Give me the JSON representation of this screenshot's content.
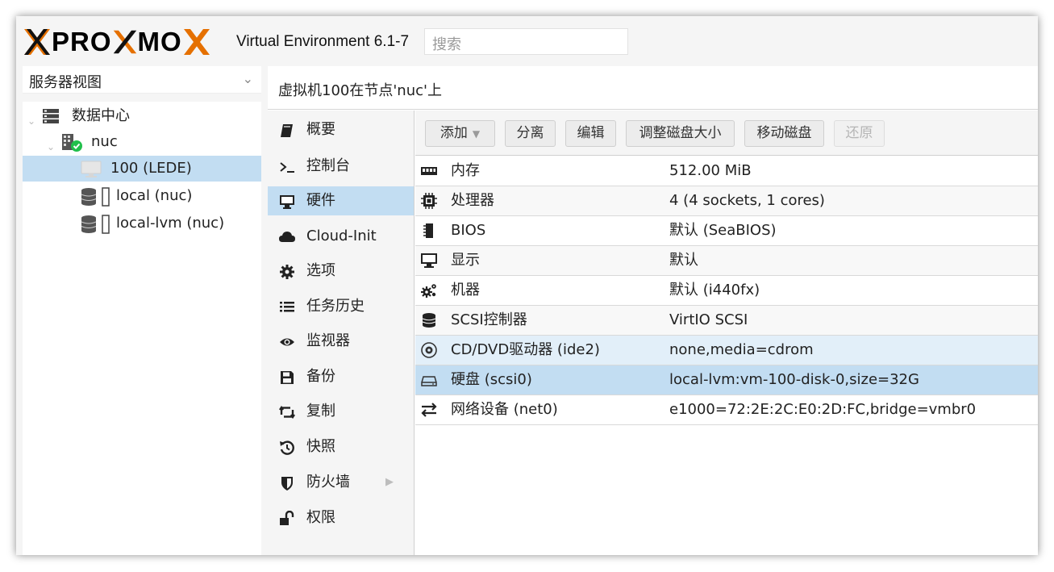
{
  "header": {
    "logo_text_left": "PRO",
    "logo_text_mid": "MO",
    "version": "Virtual Environment 6.1-7",
    "search_placeholder": "搜索",
    "brand_orange": "#e57000"
  },
  "tree": {
    "view_label": "服务器视图",
    "nodes": [
      {
        "label": "数据中心",
        "icon": "server-stack-icon"
      },
      {
        "label": "nuc",
        "icon": "node-online-icon"
      },
      {
        "label": "100 (LEDE)",
        "icon": "vm-monitor-icon",
        "selected": true
      },
      {
        "label": "local (nuc)",
        "icon": "storage-icon"
      },
      {
        "label": "local-lvm (nuc)",
        "icon": "storage-icon"
      }
    ]
  },
  "main": {
    "title": "虚拟机100在节点'nuc'上",
    "nav": [
      {
        "label": "概要",
        "icon": "book-icon"
      },
      {
        "label": "控制台",
        "icon": "terminal-icon"
      },
      {
        "label": "硬件",
        "icon": "desktop-icon",
        "selected": true
      },
      {
        "label": "Cloud-Init",
        "icon": "cloud-icon"
      },
      {
        "label": "选项",
        "icon": "gear-icon"
      },
      {
        "label": "任务历史",
        "icon": "list-icon"
      },
      {
        "label": "监视器",
        "icon": "eye-icon"
      },
      {
        "label": "备份",
        "icon": "floppy-icon"
      },
      {
        "label": "复制",
        "icon": "retweet-icon"
      },
      {
        "label": "快照",
        "icon": "history-icon"
      },
      {
        "label": "防火墙",
        "icon": "shield-icon",
        "submenu": true
      },
      {
        "label": "权限",
        "icon": "unlock-icon"
      }
    ],
    "toolbar": {
      "add": "添加",
      "detach": "分离",
      "edit": "编辑",
      "resize": "调整磁盘大小",
      "move": "移动磁盘",
      "revert": "还原"
    },
    "hardware": [
      {
        "key": "内存",
        "value": "512.00 MiB",
        "icon": "memory-icon"
      },
      {
        "key": "处理器",
        "value": "4 (4 sockets, 1 cores)",
        "icon": "cpu-icon"
      },
      {
        "key": "BIOS",
        "value": "默认 (SeaBIOS)",
        "icon": "microchip-icon"
      },
      {
        "key": "显示",
        "value": "默认",
        "icon": "desktop-icon"
      },
      {
        "key": "机器",
        "value": "默认 (i440fx)",
        "icon": "cogs-icon"
      },
      {
        "key": "SCSI控制器",
        "value": "VirtIO SCSI",
        "icon": "database-icon"
      },
      {
        "key": "CD/DVD驱动器 (ide2)",
        "value": "none,media=cdrom",
        "icon": "cdrom-icon",
        "state": "hover"
      },
      {
        "key": "硬盘 (scsi0)",
        "value": "local-lvm:vm-100-disk-0,size=32G",
        "icon": "hdd-icon",
        "state": "selected"
      },
      {
        "key": "网络设备 (net0)",
        "value": "e1000=72:2E:2C:E0:2D:FC,bridge=vmbr0",
        "icon": "exchange-icon"
      }
    ]
  }
}
